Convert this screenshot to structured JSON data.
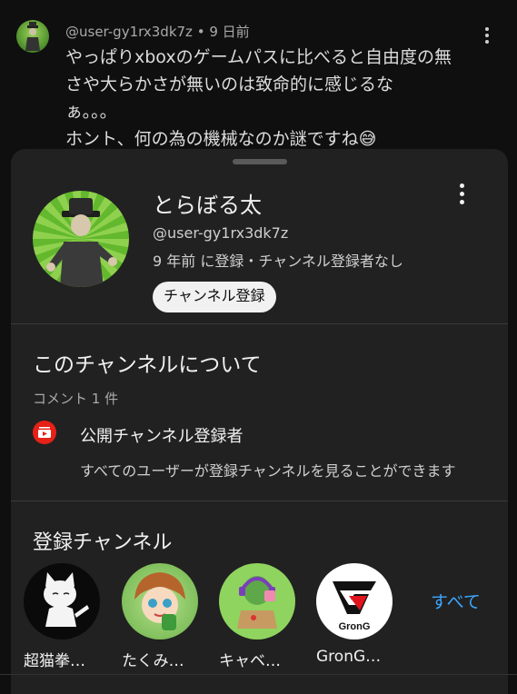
{
  "comment": {
    "author": "@user-gy1rx3dk7z",
    "time": "9 日前",
    "meta_sep": " • ",
    "lines": [
      "やっぱりxboxのゲームパスに比べると自由度の無",
      "さや大らかさが無いのは致命的に感じるな",
      "ぁ。。。",
      "ホント、何の為の機械なのか謎ですね😅"
    ]
  },
  "channel": {
    "name": "とらぼる太",
    "handle": "@user-gy1rx3dk7z",
    "info": "9 年前 に登録・チャンネル登録者なし",
    "subscribe_label": "チャンネル登録"
  },
  "about": {
    "title": "このチャンネルについて",
    "comment_count": "コメント 1 件",
    "public_title": "公開チャンネル登録者",
    "public_desc": "すべてのユーザーが登録チャンネルを見ることができます"
  },
  "subscriptions": {
    "title": "登録チャンネル",
    "items": [
      {
        "label": "超猫拳…"
      },
      {
        "label": "たくみ…"
      },
      {
        "label": "キャベ…"
      },
      {
        "label": "GronG…"
      }
    ],
    "see_all": "すべて",
    "grong_logo_text": "GronG"
  },
  "colors": {
    "background": "#0f0f0f",
    "sheet": "#212121",
    "link": "#3ea6ff",
    "subscriptions_icon": "#e62117"
  },
  "icons": [
    "more-vert-icon",
    "subscriptions-icon",
    "drag-handle"
  ]
}
